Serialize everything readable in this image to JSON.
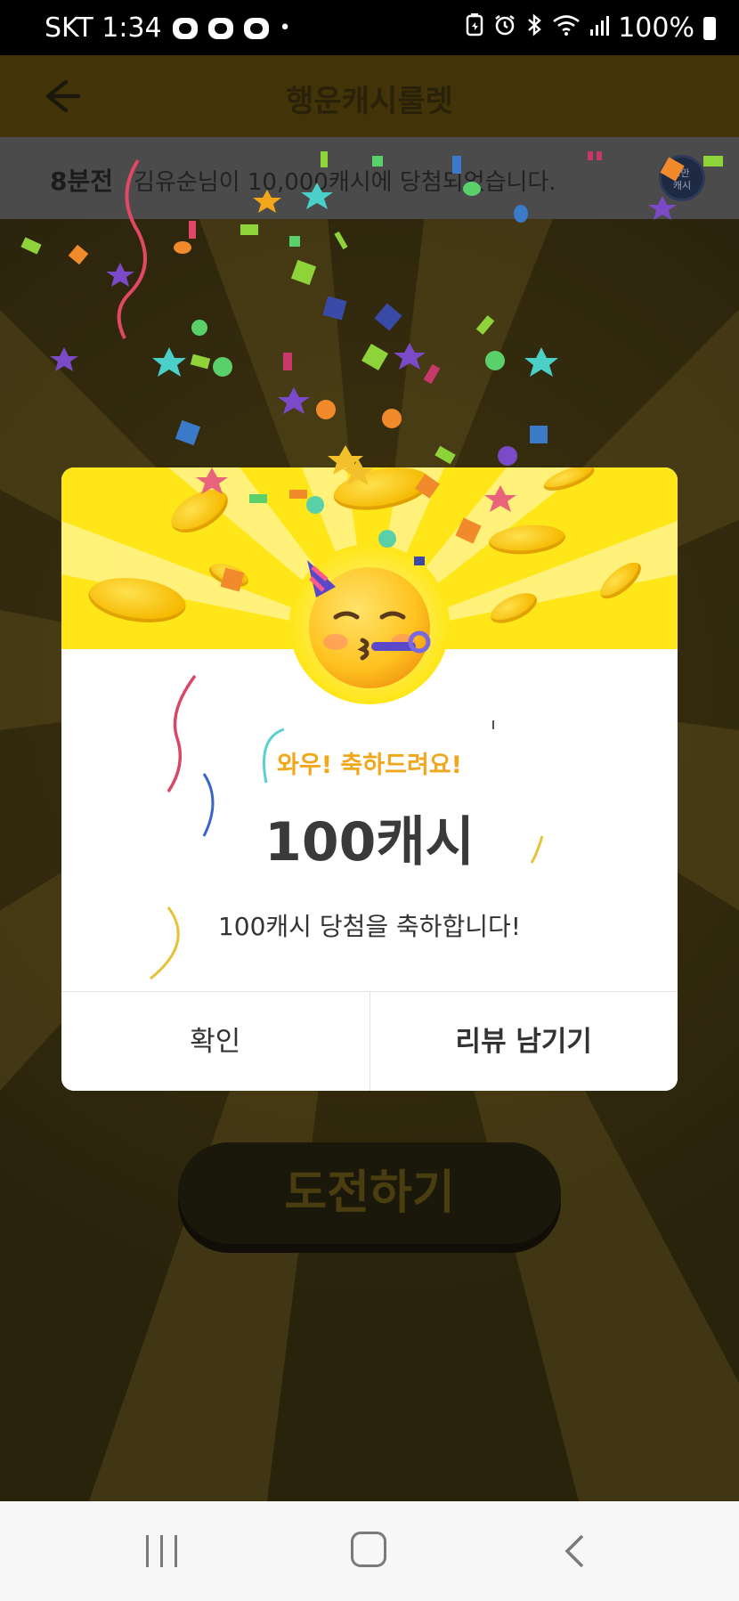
{
  "status_bar": {
    "carrier_time": "SKT 1:34",
    "dot": "•",
    "battery": "100%",
    "icons": [
      "chat-icon",
      "chat-icon",
      "chat-icon",
      "battery-saver-icon",
      "alarm-icon",
      "bluetooth-icon",
      "wifi-icon",
      "signal-icon",
      "battery-icon"
    ]
  },
  "app_bar": {
    "title": "행운캐시룰렛",
    "back_icon": "arrow-left-icon"
  },
  "ticker": {
    "time": "8분전",
    "message": "김유순님이 10,000캐시에 당첨되었습니다.",
    "badge_line1": "1만",
    "badge_line2": "캐시"
  },
  "dialog": {
    "subtitle": "와우! 축하드려요!",
    "amount": "100캐시",
    "message": "100캐시 당첨을 축하합니다!",
    "confirm_label": "확인",
    "review_label": "리뷰 남기기",
    "emoji": "partying-face-icon"
  },
  "play_button": {
    "label": "도전하기"
  },
  "nav_bar": {
    "icons": [
      "recent-apps-icon",
      "home-icon",
      "back-icon"
    ]
  },
  "colors": {
    "accent_yellow": "#ffe619",
    "subtitle_orange": "#f2a71b",
    "dim_background": "#2c2410"
  }
}
